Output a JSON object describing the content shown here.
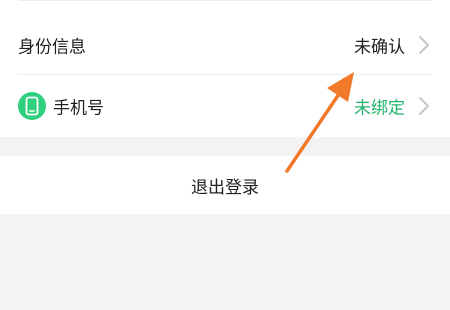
{
  "settings": {
    "identity": {
      "label": "身份信息",
      "value": "未确认"
    },
    "phone": {
      "label": "手机号",
      "value": "未绑定",
      "icon": "phone-icon"
    }
  },
  "logout": {
    "label": "退出登录"
  },
  "colors": {
    "accent_green": "#22b36b",
    "phone_icon_bg": "#2fd07c",
    "annotation_arrow": "#f07a2a"
  }
}
